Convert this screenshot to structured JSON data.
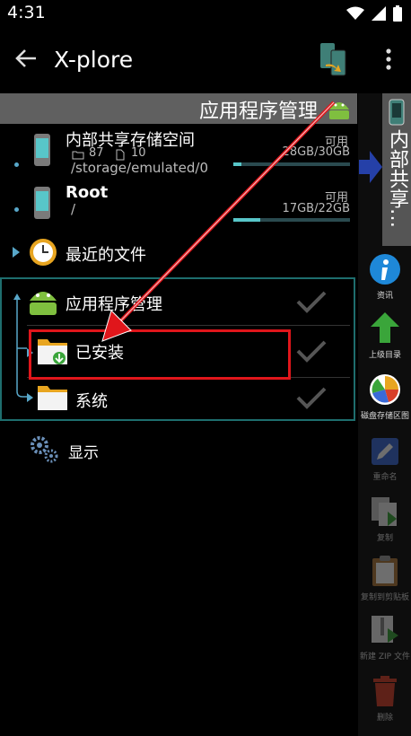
{
  "status": {
    "time": "4:31"
  },
  "app": {
    "title": "X-plore"
  },
  "left_path": "应用程序管理",
  "right_path": "内部共享…",
  "drives": [
    {
      "label": "内部共享存储空间",
      "folders": "87",
      "files": "10",
      "path": "/storage/emulated/0",
      "avail_label": "可用",
      "avail": "28GB/30GB",
      "fill_pct": 7
    },
    {
      "label": "Root",
      "path": "/",
      "avail_label": "可用",
      "avail": "17GB/22GB",
      "fill_pct": 23
    }
  ],
  "recent": {
    "label": "最近的文件"
  },
  "app_manager": {
    "label": "应用程序管理",
    "installed": "已安装",
    "system": "系统"
  },
  "display": {
    "label": "显示"
  },
  "toolbar": {
    "info": "资讯",
    "up": "上级目录",
    "disk": "磁盘存储区图",
    "rename": "重命名",
    "copy": "复制",
    "clipboard": "复制到剪贴板",
    "zip": "新建 ZIP 文件",
    "delete": "删除"
  },
  "colors": {
    "accent": "#58c6c9",
    "annotation": "#e0161b",
    "path_bar": "#606060"
  }
}
